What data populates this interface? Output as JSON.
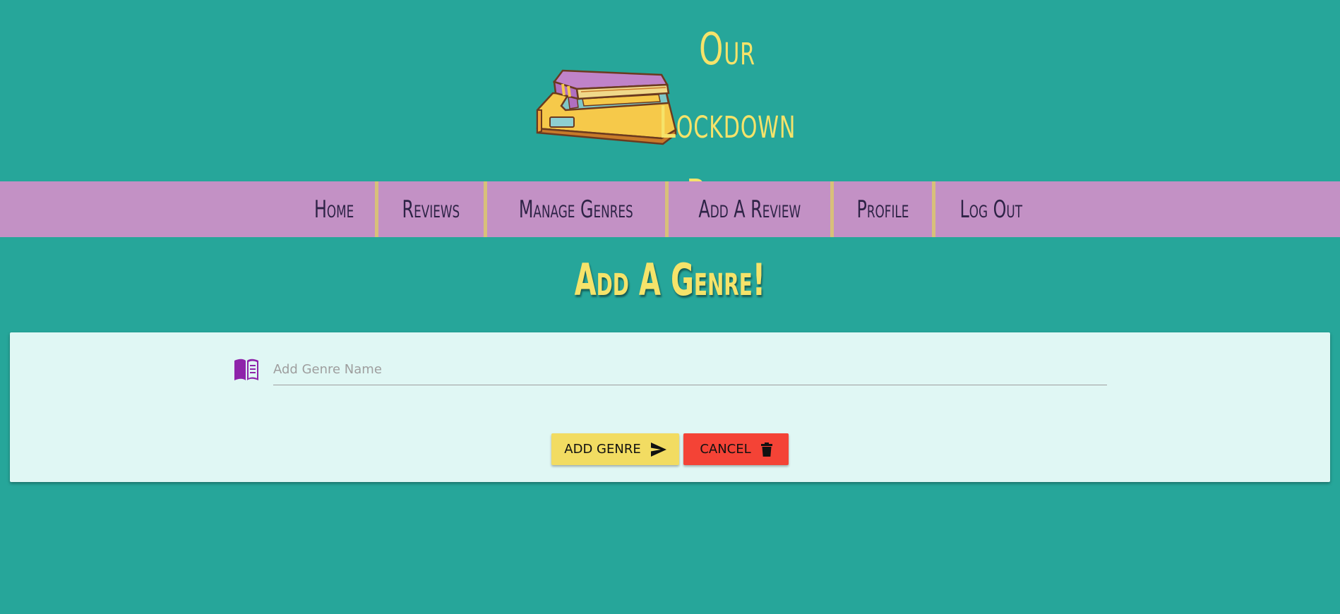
{
  "header": {
    "title_line1": "Our Lockdown",
    "title_line2": "Reads"
  },
  "nav": {
    "items": [
      {
        "label": "Home"
      },
      {
        "label": "Reviews"
      },
      {
        "label": "Manage Genres"
      },
      {
        "label": "Add A Review"
      },
      {
        "label": "Profile"
      },
      {
        "label": "Log Out"
      }
    ]
  },
  "page": {
    "heading": "Add A Genre!"
  },
  "form": {
    "genre_name_placeholder": "Add Genre Name",
    "genre_name_value": "",
    "field_icon": "open-book-icon",
    "add_button_label": "ADD GENRE",
    "add_button_icon": "send-icon",
    "cancel_button_label": "CANCEL",
    "cancel_button_icon": "trash-icon"
  },
  "colors": {
    "background": "#26a69a",
    "nav_background": "#c391c5",
    "accent_yellow": "#f5e36a",
    "card_background": "#e0f7f4",
    "add_button": "#f2dc62",
    "cancel_button": "#f44336",
    "icon_purple": "#8e24aa"
  }
}
